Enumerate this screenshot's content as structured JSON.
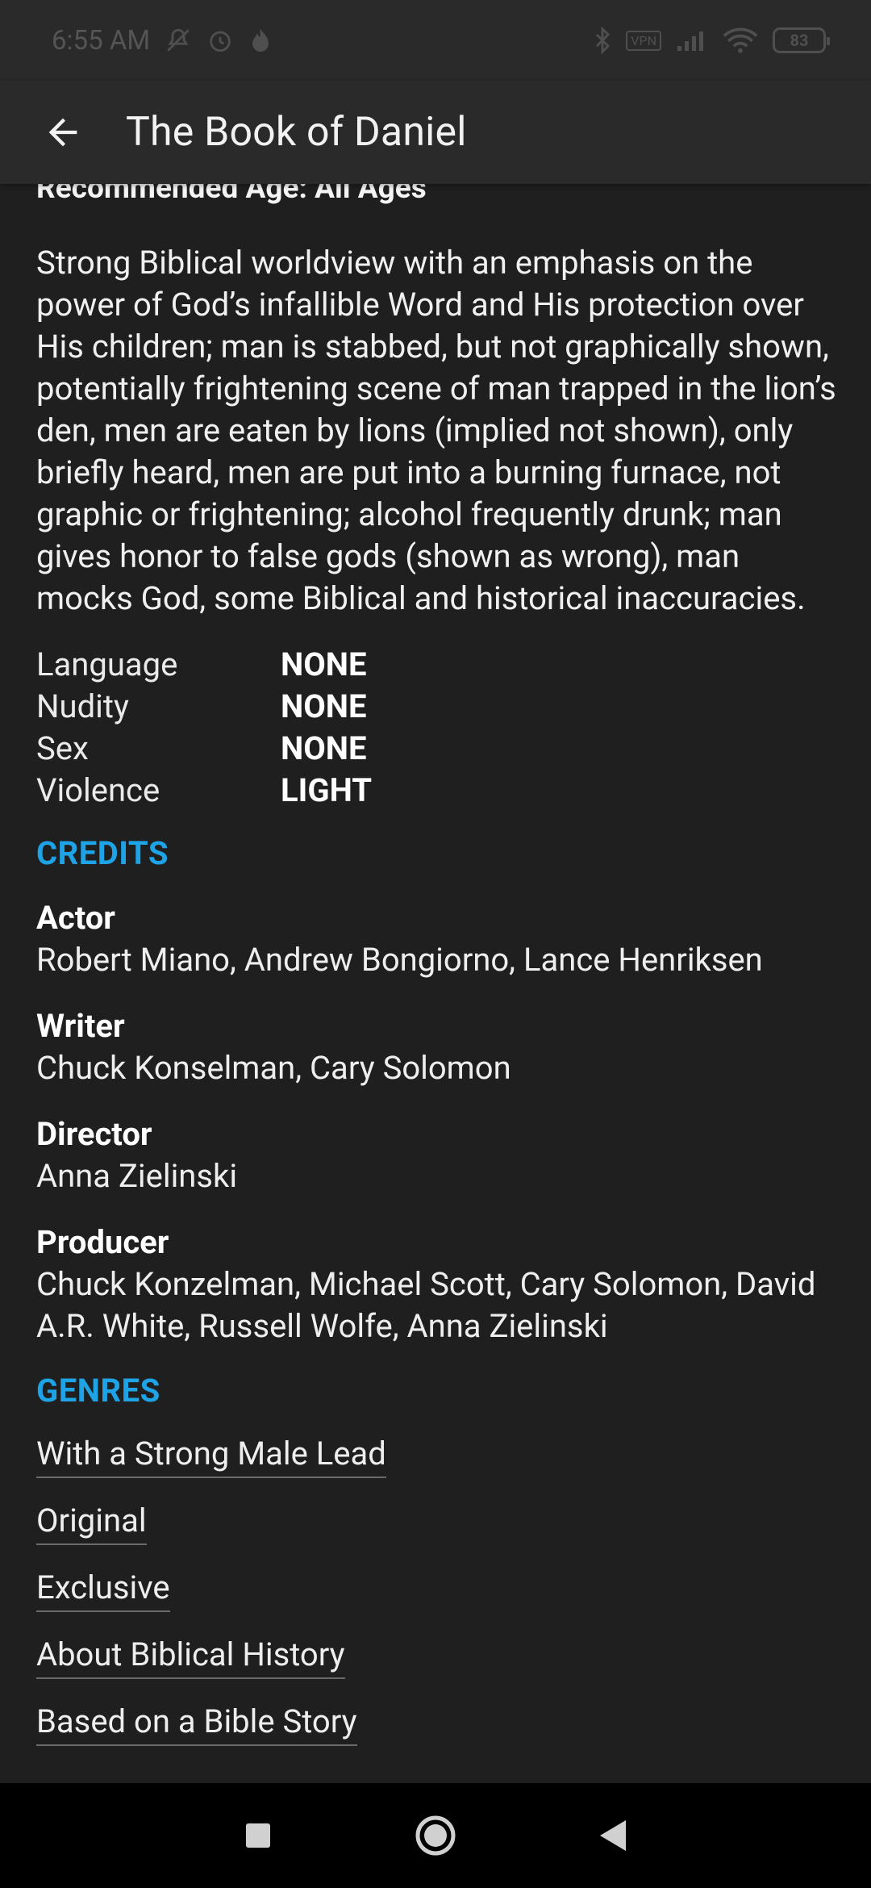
{
  "status_bar": {
    "time": "6:55 AM",
    "vpn_label": "VPN",
    "battery": "83"
  },
  "app_bar": {
    "title": "The Book of Daniel"
  },
  "content": {
    "age_line": "Recommended Age: All Ages",
    "summary": "Strong Biblical worldview with an emphasis on the power of God’s infallible Word and His protection over His children; man is stabbed, but not graphically shown, potentially frightening scene of man trapped in the lion’s den, men are eaten by lions (implied not shown), only briefly heard, men are put into a burning furnace, not graphic or frightening; alcohol frequently drunk; man gives honor to false gods (shown as wrong), man mocks God, some Biblical and historical inaccuracies.",
    "ratings": [
      {
        "label": "Language",
        "value": "NONE"
      },
      {
        "label": "Nudity",
        "value": "NONE"
      },
      {
        "label": "Sex",
        "value": "NONE"
      },
      {
        "label": "Violence",
        "value": "LIGHT"
      }
    ],
    "credits_heading": "CREDITS",
    "credits": [
      {
        "role": "Actor",
        "names": "Robert Miano, Andrew Bongiorno, Lance Henriksen"
      },
      {
        "role": "Writer",
        "names": "Chuck Konselman, Cary Solomon"
      },
      {
        "role": "Director",
        "names": "Anna Zielinski"
      },
      {
        "role": "Producer",
        "names": "Chuck Konzelman, Michael Scott, Cary Solomon, David A.R. White, Russell Wolfe, Anna Zielinski"
      }
    ],
    "genres_heading": "GENRES",
    "genres": [
      "With a Strong Male Lead",
      "Original",
      "Exclusive",
      "About Biblical History",
      "Based on a Bible Story"
    ]
  },
  "colors": {
    "accent": "#1ea4e6",
    "background": "#1f1f1f",
    "app_bar": "#2a2a2a",
    "nav_bar": "#000000"
  }
}
